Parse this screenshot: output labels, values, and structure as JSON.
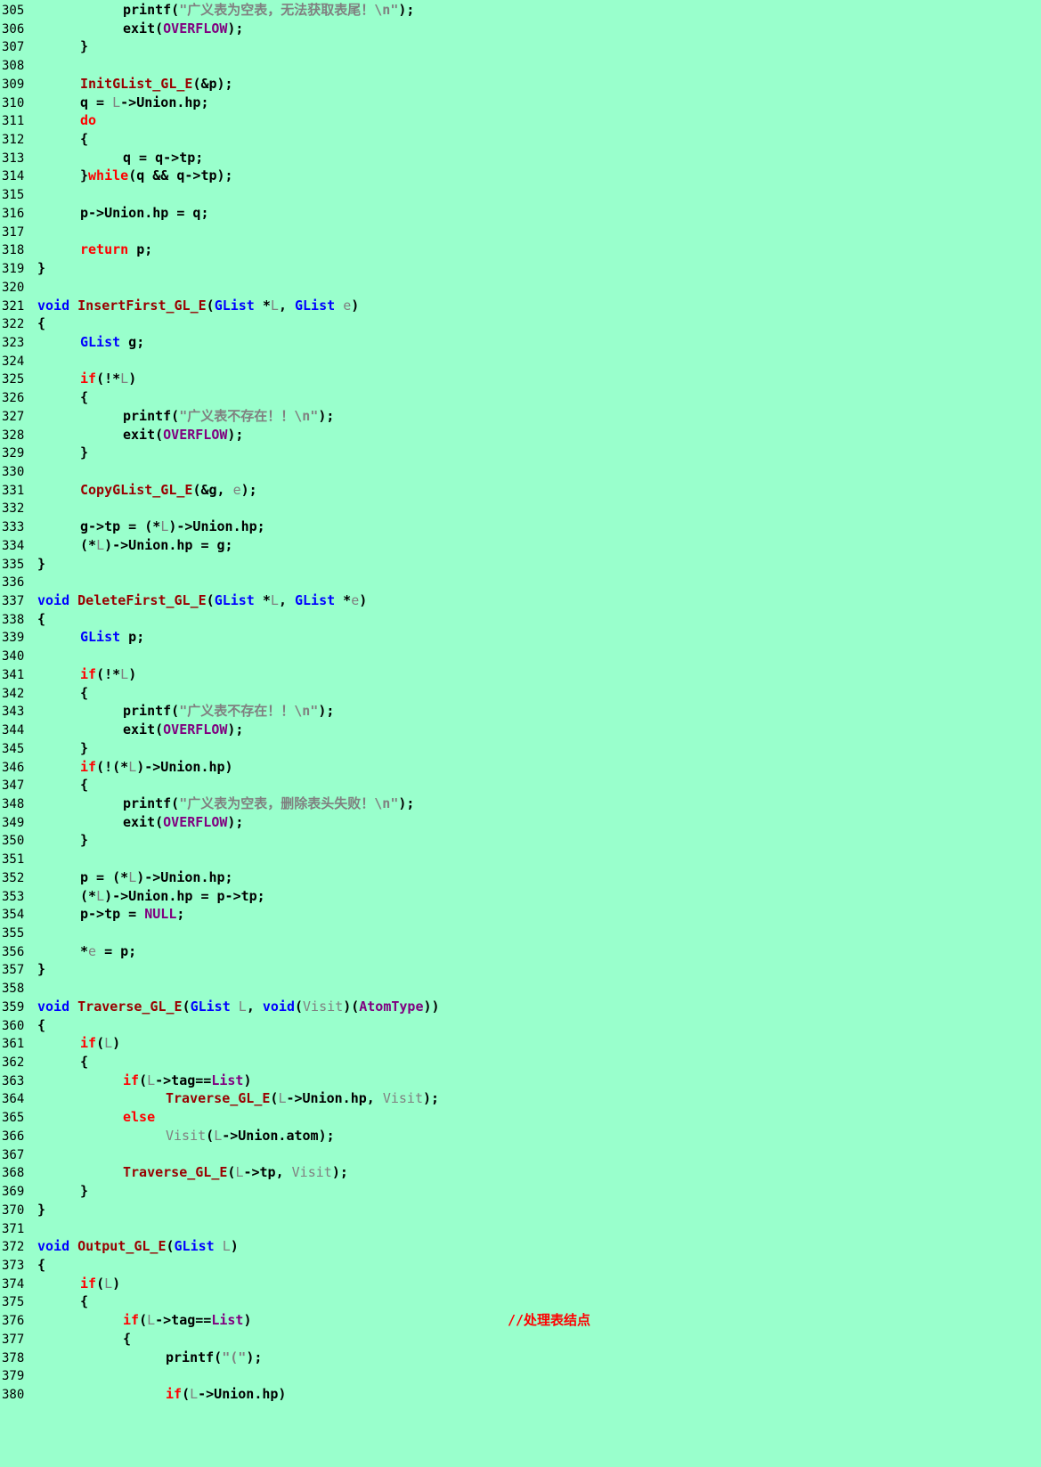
{
  "document": {
    "background": "#99ffcc",
    "token_colors": {
      "kw": "#ff0000",
      "ty": "#0000ff",
      "fn": "#990000",
      "par": "#808080",
      "str": "#808080",
      "mac": "#800080",
      "cmt": "#ff0000",
      "plain": "#000000"
    },
    "lines": [
      {
        "n": "305",
        "t": [
          [
            "",
            "\t\tprintf("
          ],
          [
            "str",
            "\"广义表为空表，无法获取表尾！\\n\""
          ],
          [
            "",
            ");"
          ]
        ]
      },
      {
        "n": "306",
        "t": [
          [
            "",
            "\t\texit("
          ],
          [
            "mac",
            "OVERFLOW"
          ],
          [
            "",
            ");"
          ]
        ]
      },
      {
        "n": "307",
        "t": [
          [
            "",
            "\t}"
          ]
        ]
      },
      {
        "n": "308",
        "t": []
      },
      {
        "n": "309",
        "t": [
          [
            "",
            "\t"
          ],
          [
            "fn",
            "InitGList_GL_E"
          ],
          [
            "",
            "(&p);"
          ]
        ]
      },
      {
        "n": "310",
        "t": [
          [
            "",
            "\tq = "
          ],
          [
            "par",
            "L"
          ],
          [
            "",
            "->Union.hp;"
          ]
        ]
      },
      {
        "n": "311",
        "t": [
          [
            "",
            "\t"
          ],
          [
            "kw",
            "do"
          ]
        ]
      },
      {
        "n": "312",
        "t": [
          [
            "",
            "\t{"
          ]
        ]
      },
      {
        "n": "313",
        "t": [
          [
            "",
            "\t\tq = q->tp;"
          ]
        ]
      },
      {
        "n": "314",
        "t": [
          [
            "",
            "\t}"
          ],
          [
            "kw",
            "while"
          ],
          [
            "",
            "(q && q->tp);"
          ]
        ]
      },
      {
        "n": "315",
        "t": []
      },
      {
        "n": "316",
        "t": [
          [
            "",
            "\tp->Union.hp = q;"
          ]
        ]
      },
      {
        "n": "317",
        "t": []
      },
      {
        "n": "318",
        "t": [
          [
            "",
            "\t"
          ],
          [
            "kw",
            "return"
          ],
          [
            "",
            " p;"
          ]
        ]
      },
      {
        "n": "319",
        "t": [
          [
            "",
            "}"
          ]
        ]
      },
      {
        "n": "320",
        "t": []
      },
      {
        "n": "321",
        "t": [
          [
            "ty",
            "void"
          ],
          [
            "",
            " "
          ],
          [
            "fn",
            "InsertFirst_GL_E"
          ],
          [
            "",
            "("
          ],
          [
            "ty",
            "GList"
          ],
          [
            "",
            " *"
          ],
          [
            "par",
            "L"
          ],
          [
            "",
            ", "
          ],
          [
            "ty",
            "GList"
          ],
          [
            "",
            " "
          ],
          [
            "par",
            "e"
          ],
          [
            "",
            ")"
          ]
        ]
      },
      {
        "n": "322",
        "t": [
          [
            "",
            "{"
          ]
        ]
      },
      {
        "n": "323",
        "t": [
          [
            "",
            "\t"
          ],
          [
            "ty",
            "GList"
          ],
          [
            "",
            " g;"
          ]
        ]
      },
      {
        "n": "324",
        "t": []
      },
      {
        "n": "325",
        "t": [
          [
            "",
            "\t"
          ],
          [
            "kw",
            "if"
          ],
          [
            "",
            "(!*"
          ],
          [
            "par",
            "L"
          ],
          [
            "",
            ")"
          ]
        ]
      },
      {
        "n": "326",
        "t": [
          [
            "",
            "\t{"
          ]
        ]
      },
      {
        "n": "327",
        "t": [
          [
            "",
            "\t\tprintf("
          ],
          [
            "str",
            "\"广义表不存在！！\\n\""
          ],
          [
            "",
            ");"
          ]
        ]
      },
      {
        "n": "328",
        "t": [
          [
            "",
            "\t\texit("
          ],
          [
            "mac",
            "OVERFLOW"
          ],
          [
            "",
            ");"
          ]
        ]
      },
      {
        "n": "329",
        "t": [
          [
            "",
            "\t}"
          ]
        ]
      },
      {
        "n": "330",
        "t": []
      },
      {
        "n": "331",
        "t": [
          [
            "",
            "\t"
          ],
          [
            "fn",
            "CopyGList_GL_E"
          ],
          [
            "",
            "(&g, "
          ],
          [
            "par",
            "e"
          ],
          [
            "",
            ");"
          ]
        ]
      },
      {
        "n": "332",
        "t": []
      },
      {
        "n": "333",
        "t": [
          [
            "",
            "\tg->tp = (*"
          ],
          [
            "par",
            "L"
          ],
          [
            "",
            ")->Union.hp;"
          ]
        ]
      },
      {
        "n": "334",
        "t": [
          [
            "",
            "\t(*"
          ],
          [
            "par",
            "L"
          ],
          [
            "",
            ")->Union.hp = g;"
          ]
        ]
      },
      {
        "n": "335",
        "t": [
          [
            "",
            "}"
          ]
        ]
      },
      {
        "n": "336",
        "t": []
      },
      {
        "n": "337",
        "t": [
          [
            "ty",
            "void"
          ],
          [
            "",
            " "
          ],
          [
            "fn",
            "DeleteFirst_GL_E"
          ],
          [
            "",
            "("
          ],
          [
            "ty",
            "GList"
          ],
          [
            "",
            " *"
          ],
          [
            "par",
            "L"
          ],
          [
            "",
            ", "
          ],
          [
            "ty",
            "GList"
          ],
          [
            "",
            " *"
          ],
          [
            "par",
            "e"
          ],
          [
            "",
            ")"
          ]
        ]
      },
      {
        "n": "338",
        "t": [
          [
            "",
            "{"
          ]
        ]
      },
      {
        "n": "339",
        "t": [
          [
            "",
            "\t"
          ],
          [
            "ty",
            "GList"
          ],
          [
            "",
            " p;"
          ]
        ]
      },
      {
        "n": "340",
        "t": []
      },
      {
        "n": "341",
        "t": [
          [
            "",
            "\t"
          ],
          [
            "kw",
            "if"
          ],
          [
            "",
            "(!*"
          ],
          [
            "par",
            "L"
          ],
          [
            "",
            ")"
          ]
        ]
      },
      {
        "n": "342",
        "t": [
          [
            "",
            "\t{"
          ]
        ]
      },
      {
        "n": "343",
        "t": [
          [
            "",
            "\t\tprintf("
          ],
          [
            "str",
            "\"广义表不存在！！\\n\""
          ],
          [
            "",
            ");"
          ]
        ]
      },
      {
        "n": "344",
        "t": [
          [
            "",
            "\t\texit("
          ],
          [
            "mac",
            "OVERFLOW"
          ],
          [
            "",
            ");"
          ]
        ]
      },
      {
        "n": "345",
        "t": [
          [
            "",
            "\t}"
          ]
        ]
      },
      {
        "n": "346",
        "t": [
          [
            "",
            "\t"
          ],
          [
            "kw",
            "if"
          ],
          [
            "",
            "(!(*"
          ],
          [
            "par",
            "L"
          ],
          [
            "",
            ")->Union.hp)"
          ]
        ]
      },
      {
        "n": "347",
        "t": [
          [
            "",
            "\t{"
          ]
        ]
      },
      {
        "n": "348",
        "t": [
          [
            "",
            "\t\tprintf("
          ],
          [
            "str",
            "\"广义表为空表，删除表头失败！\\n\""
          ],
          [
            "",
            ");"
          ]
        ]
      },
      {
        "n": "349",
        "t": [
          [
            "",
            "\t\texit("
          ],
          [
            "mac",
            "OVERFLOW"
          ],
          [
            "",
            ");"
          ]
        ]
      },
      {
        "n": "350",
        "t": [
          [
            "",
            "\t}"
          ]
        ]
      },
      {
        "n": "351",
        "t": []
      },
      {
        "n": "352",
        "t": [
          [
            "",
            "\tp = (*"
          ],
          [
            "par",
            "L"
          ],
          [
            "",
            ")->Union.hp;"
          ]
        ]
      },
      {
        "n": "353",
        "t": [
          [
            "",
            "\t(*"
          ],
          [
            "par",
            "L"
          ],
          [
            "",
            ")->Union.hp = p->tp;"
          ]
        ]
      },
      {
        "n": "354",
        "t": [
          [
            "",
            "\tp->tp = "
          ],
          [
            "mac",
            "NULL"
          ],
          [
            "",
            ";"
          ]
        ]
      },
      {
        "n": "355",
        "t": []
      },
      {
        "n": "356",
        "t": [
          [
            "",
            "\t*"
          ],
          [
            "par",
            "e"
          ],
          [
            "",
            " = p;"
          ]
        ]
      },
      {
        "n": "357",
        "t": [
          [
            "",
            "}"
          ]
        ]
      },
      {
        "n": "358",
        "t": []
      },
      {
        "n": "359",
        "t": [
          [
            "ty",
            "void"
          ],
          [
            "",
            " "
          ],
          [
            "fn",
            "Traverse_GL_E"
          ],
          [
            "",
            "("
          ],
          [
            "ty",
            "GList"
          ],
          [
            "",
            " "
          ],
          [
            "par",
            "L"
          ],
          [
            "",
            ", "
          ],
          [
            "ty",
            "void"
          ],
          [
            "",
            "("
          ],
          [
            "par",
            "Visit"
          ],
          [
            "",
            ")("
          ],
          [
            "mac",
            "AtomType"
          ],
          [
            "",
            "))"
          ]
        ]
      },
      {
        "n": "360",
        "t": [
          [
            "",
            "{"
          ]
        ]
      },
      {
        "n": "361",
        "t": [
          [
            "",
            "\t"
          ],
          [
            "kw",
            "if"
          ],
          [
            "",
            "("
          ],
          [
            "par",
            "L"
          ],
          [
            "",
            ")"
          ]
        ]
      },
      {
        "n": "362",
        "t": [
          [
            "",
            "\t{"
          ]
        ]
      },
      {
        "n": "363",
        "t": [
          [
            "",
            "\t\t"
          ],
          [
            "kw",
            "if"
          ],
          [
            "",
            "("
          ],
          [
            "par",
            "L"
          ],
          [
            "",
            "->tag=="
          ],
          [
            "mac",
            "List"
          ],
          [
            "",
            ")"
          ]
        ]
      },
      {
        "n": "364",
        "t": [
          [
            "",
            "\t\t\t"
          ],
          [
            "fn",
            "Traverse_GL_E"
          ],
          [
            "",
            "("
          ],
          [
            "par",
            "L"
          ],
          [
            "",
            "->Union.hp, "
          ],
          [
            "par",
            "Visit"
          ],
          [
            "",
            ");"
          ]
        ]
      },
      {
        "n": "365",
        "t": [
          [
            "",
            "\t\t"
          ],
          [
            "kw",
            "else"
          ]
        ]
      },
      {
        "n": "366",
        "t": [
          [
            "",
            "\t\t\t"
          ],
          [
            "par",
            "Visit"
          ],
          [
            "",
            "("
          ],
          [
            "par",
            "L"
          ],
          [
            "",
            "->Union.atom);"
          ]
        ]
      },
      {
        "n": "367",
        "t": []
      },
      {
        "n": "368",
        "t": [
          [
            "",
            "\t\t"
          ],
          [
            "fn",
            "Traverse_GL_E"
          ],
          [
            "",
            "("
          ],
          [
            "par",
            "L"
          ],
          [
            "",
            "->tp, "
          ],
          [
            "par",
            "Visit"
          ],
          [
            "",
            ");"
          ]
        ]
      },
      {
        "n": "369",
        "t": [
          [
            "",
            "\t}"
          ]
        ]
      },
      {
        "n": "370",
        "t": [
          [
            "",
            "}"
          ]
        ]
      },
      {
        "n": "371",
        "t": []
      },
      {
        "n": "372",
        "t": [
          [
            "ty",
            "void"
          ],
          [
            "",
            " "
          ],
          [
            "fn",
            "Output_GL_E"
          ],
          [
            "",
            "("
          ],
          [
            "ty",
            "GList"
          ],
          [
            "",
            " "
          ],
          [
            "par",
            "L"
          ],
          [
            "",
            ")"
          ]
        ]
      },
      {
        "n": "373",
        "t": [
          [
            "",
            "{"
          ]
        ]
      },
      {
        "n": "374",
        "t": [
          [
            "",
            "\t"
          ],
          [
            "kw",
            "if"
          ],
          [
            "",
            "("
          ],
          [
            "par",
            "L"
          ],
          [
            "",
            ")"
          ]
        ]
      },
      {
        "n": "375",
        "t": [
          [
            "",
            "\t{"
          ]
        ]
      },
      {
        "n": "376",
        "t": [
          [
            "",
            "\t\t"
          ],
          [
            "kw",
            "if"
          ],
          [
            "",
            "("
          ],
          [
            "par",
            "L"
          ],
          [
            "",
            "->tag=="
          ],
          [
            "mac",
            "List"
          ],
          [
            "",
            ")\t\t\t\t\t\t"
          ],
          [
            "cmt",
            "//处理表结点"
          ]
        ]
      },
      {
        "n": "377",
        "t": [
          [
            "",
            "\t\t{"
          ]
        ]
      },
      {
        "n": "378",
        "t": [
          [
            "",
            "\t\t\tprintf("
          ],
          [
            "str",
            "\"(\""
          ],
          [
            "",
            ");"
          ]
        ]
      },
      {
        "n": "379",
        "t": []
      },
      {
        "n": "380",
        "t": [
          [
            "",
            "\t\t\t"
          ],
          [
            "kw",
            "if"
          ],
          [
            "",
            "("
          ],
          [
            "par",
            "L"
          ],
          [
            "",
            "->Union.hp)"
          ]
        ]
      }
    ]
  }
}
